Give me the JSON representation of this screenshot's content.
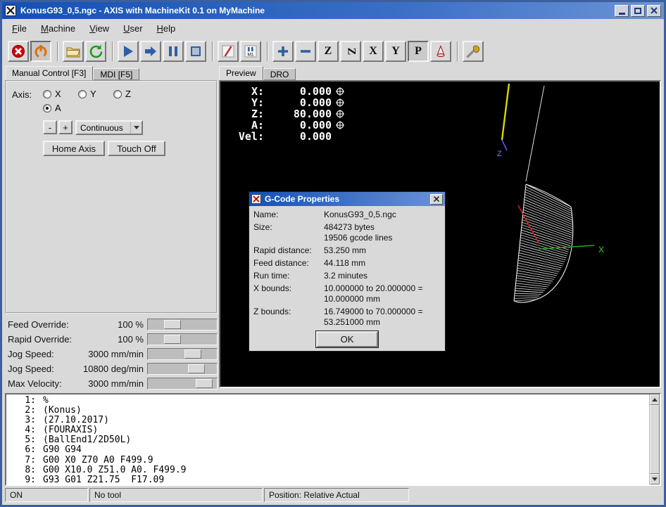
{
  "window": {
    "title": "KonusG93_0,5.ngc - AXIS with MachineKit 0.1 on MyMachine"
  },
  "menu": {
    "items": [
      {
        "label": "File"
      },
      {
        "label": "Machine"
      },
      {
        "label": "View"
      },
      {
        "label": "User"
      },
      {
        "label": "Help"
      }
    ]
  },
  "toolbar": {
    "view_letters": [
      "Z",
      "Z",
      "X",
      "Y",
      "P"
    ],
    "m1_label": "M1"
  },
  "left_panel": {
    "tabs": [
      {
        "label": "Manual Control [F3]"
      },
      {
        "label": "MDI [F5]"
      }
    ],
    "axis_label": "Axis:",
    "axes": [
      {
        "label": "X"
      },
      {
        "label": "Y"
      },
      {
        "label": "Z"
      },
      {
        "label": "A"
      }
    ],
    "selected_axis": "A",
    "jog_minus": "-",
    "jog_plus": "+",
    "jog_mode": "Continuous",
    "home_button": "Home Axis",
    "touchoff_button": "Touch Off",
    "sliders": [
      {
        "label": "Feed Override:",
        "value": "100 %"
      },
      {
        "label": "Rapid Override:",
        "value": "100 %"
      },
      {
        "label": "Jog Speed:",
        "value": "3000 mm/min"
      },
      {
        "label": "Jog Speed:",
        "value": "10800 deg/min"
      },
      {
        "label": "Max Velocity:",
        "value": "3000 mm/min"
      }
    ]
  },
  "right_panel": {
    "tabs": [
      {
        "label": "Preview"
      },
      {
        "label": "DRO"
      }
    ],
    "dro": [
      {
        "label": "X:",
        "value": "0.000"
      },
      {
        "label": "Y:",
        "value": "0.000"
      },
      {
        "label": "Z:",
        "value": "80.000"
      },
      {
        "label": "A:",
        "value": "0.000"
      },
      {
        "label": "Vel:",
        "value": "0.000"
      }
    ],
    "scene": {
      "x_axis_label": "X",
      "z_axis_label": "Z"
    }
  },
  "dialog": {
    "title": "G-Code Properties",
    "rows": [
      {
        "label": "Name:",
        "value": "KonusG93_0,5.ngc"
      },
      {
        "label": "Size:",
        "value": "484273 bytes\n19506 gcode lines"
      },
      {
        "label": "Rapid distance:",
        "value": "53.250 mm"
      },
      {
        "label": "Feed distance:",
        "value": "44.118 mm"
      },
      {
        "label": "Run time:",
        "value": "3.2 minutes"
      },
      {
        "label": "X bounds:",
        "value": "10.000000 to 20.000000 =\n10.000000 mm"
      },
      {
        "label": "Z bounds:",
        "value": "16.749000 to 70.000000 =\n53.251000 mm"
      }
    ],
    "ok_button": "OK"
  },
  "gcode": {
    "lines": [
      {
        "num": "1:",
        "text": "%"
      },
      {
        "num": "2:",
        "text": "(Konus)"
      },
      {
        "num": "3:",
        "text": "(27.10.2017)"
      },
      {
        "num": "4:",
        "text": "(FOURAXIS)"
      },
      {
        "num": "5:",
        "text": "(BallEnd1/2D50L)"
      },
      {
        "num": "6:",
        "text": "G90 G94"
      },
      {
        "num": "7:",
        "text": "G00 X0 Z70 A0 F499.9"
      },
      {
        "num": "8:",
        "text": "G00 X10.0 Z51.0 A0. F499.9"
      },
      {
        "num": "9:",
        "text": "G93 G01 Z21.75  F17.09"
      }
    ]
  },
  "statusbar": {
    "cells": [
      {
        "text": "ON"
      },
      {
        "text": "No tool"
      },
      {
        "text": "Position: Relative Actual"
      }
    ]
  }
}
